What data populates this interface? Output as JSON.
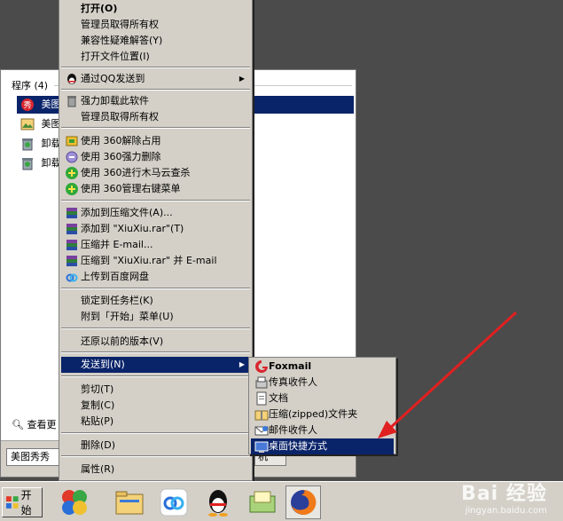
{
  "start_panel": {
    "header": "程序 (4)",
    "items": [
      {
        "label": "美图",
        "icon": "meitu-red-icon"
      },
      {
        "label": "美图",
        "icon": "meitu-image-icon"
      },
      {
        "label": "卸载",
        "icon": "uninstall-icon"
      },
      {
        "label": "卸载",
        "icon": "uninstall-icon"
      }
    ],
    "see_more": "查看更",
    "search_value": "美图秀秀",
    "shutdown_label": "机"
  },
  "context_menu": {
    "items": [
      {
        "label": "打开(O)",
        "bold": true
      },
      {
        "label": "管理员取得所有权"
      },
      {
        "label": "兼容性疑难解答(Y)"
      },
      {
        "label": "打开文件位置(I)"
      },
      {
        "label": "通过QQ发送到",
        "icon": "qq-icon",
        "submenu": true
      },
      {
        "label": "强力卸载此软件",
        "icon": "trash-icon"
      },
      {
        "label": "管理员取得所有权"
      },
      {
        "label": "使用 360解除占用",
        "icon": "360-unlock-icon"
      },
      {
        "label": "使用 360强力删除",
        "icon": "360-delete-icon"
      },
      {
        "label": "使用 360进行木马云查杀",
        "icon": "360-plus-icon"
      },
      {
        "label": "使用 360管理右键菜单",
        "icon": "360-plus-icon"
      },
      {
        "label": "添加到压缩文件(A)...",
        "icon": "winrar-icon"
      },
      {
        "label": "添加到 \"XiuXiu.rar\"(T)",
        "icon": "winrar-icon"
      },
      {
        "label": "压缩并 E-mail...",
        "icon": "winrar-icon"
      },
      {
        "label": "压缩到 \"XiuXiu.rar\" 并 E-mail",
        "icon": "winrar-icon"
      },
      {
        "label": "上传到百度网盘",
        "icon": "baidu-pan-icon"
      },
      {
        "label": "锁定到任务栏(K)"
      },
      {
        "label": "附到「开始」菜单(U)"
      },
      {
        "label": "还原以前的版本(V)"
      },
      {
        "label": "发送到(N)",
        "submenu": true,
        "selected": true
      },
      {
        "label": "剪切(T)"
      },
      {
        "label": "复制(C)"
      },
      {
        "label": "粘贴(P)"
      },
      {
        "label": "删除(D)"
      },
      {
        "label": "属性(R)"
      }
    ]
  },
  "send_to_menu": {
    "items": [
      {
        "label": "Foxmail",
        "icon": "foxmail-icon",
        "bold": true
      },
      {
        "label": "传真收件人",
        "icon": "fax-icon"
      },
      {
        "label": "文档",
        "icon": "document-icon"
      },
      {
        "label": "压缩(zipped)文件夹",
        "icon": "zip-folder-icon"
      },
      {
        "label": "邮件收件人",
        "icon": "mail-icon"
      },
      {
        "label": "桌面快捷方式",
        "icon": "desktop-icon",
        "selected": true
      }
    ]
  },
  "taskbar": {
    "start_label": "开始",
    "apps": [
      "color-balls-icon",
      "file-explorer-icon",
      "baidu-pan-icon",
      "qq-penguin-icon",
      "folder-green-icon",
      "firefox-icon"
    ]
  },
  "watermark": {
    "brand": "Bai 经验",
    "url": "jingyan.baidu.com"
  },
  "colors": {
    "selection": "#0a246a",
    "menu_bg": "#d4d0c8",
    "desktop": "#4b4b4b",
    "arrow": "#e02020"
  }
}
